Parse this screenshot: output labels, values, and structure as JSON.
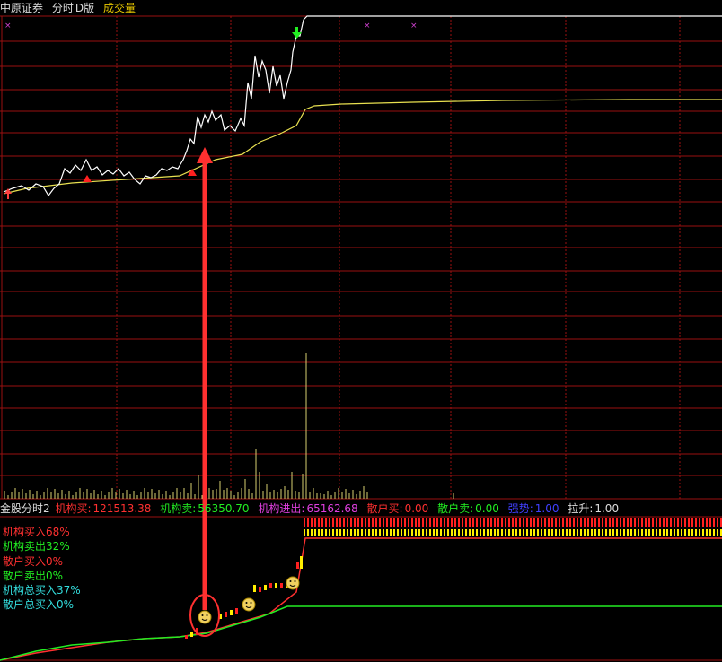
{
  "header": {
    "broker": "中原证券",
    "period": "分时",
    "version": "D版",
    "volume_label": "成交量"
  },
  "indicator": {
    "name": "金股分时2",
    "inst_buy_label": "机构买:",
    "inst_buy_value": "121513.38",
    "inst_sell_label": "机构卖:",
    "inst_sell_value": "56350.70",
    "inst_net_label": "机构进出:",
    "inst_net_value": "65162.68",
    "retail_buy_label": "散户买:",
    "retail_buy_value": "0.00",
    "retail_sell_label": "散户卖:",
    "retail_sell_value": "0.00",
    "strength_label": "强势:",
    "strength_value": "1.00",
    "pull_label": "拉升:",
    "pull_value": "1.00"
  },
  "legend": [
    {
      "text": "机构买入68%",
      "color": "#ff3030"
    },
    {
      "text": "机构卖出32%",
      "color": "#22ee22"
    },
    {
      "text": "散户买入0%",
      "color": "#ff3030"
    },
    {
      "text": "散户卖出0%",
      "color": "#22ee22"
    },
    {
      "text": "机构总买入37%",
      "color": "#33dddd"
    },
    {
      "text": "散户总买入0%",
      "color": "#33dddd"
    }
  ],
  "colors": {
    "grid": "#9a1010",
    "price_line": "#ffffff",
    "avg_line": "#e8e050",
    "volume_bar": "#d8d070",
    "inst_total_line": "#22ee22",
    "inst_buy_line": "#ff3030",
    "signal_arrow": "#ff3030"
  },
  "icons": [
    "up-arrow-icon",
    "down-arrow-icon",
    "smiley-icon",
    "cross-marker-icon"
  ]
}
